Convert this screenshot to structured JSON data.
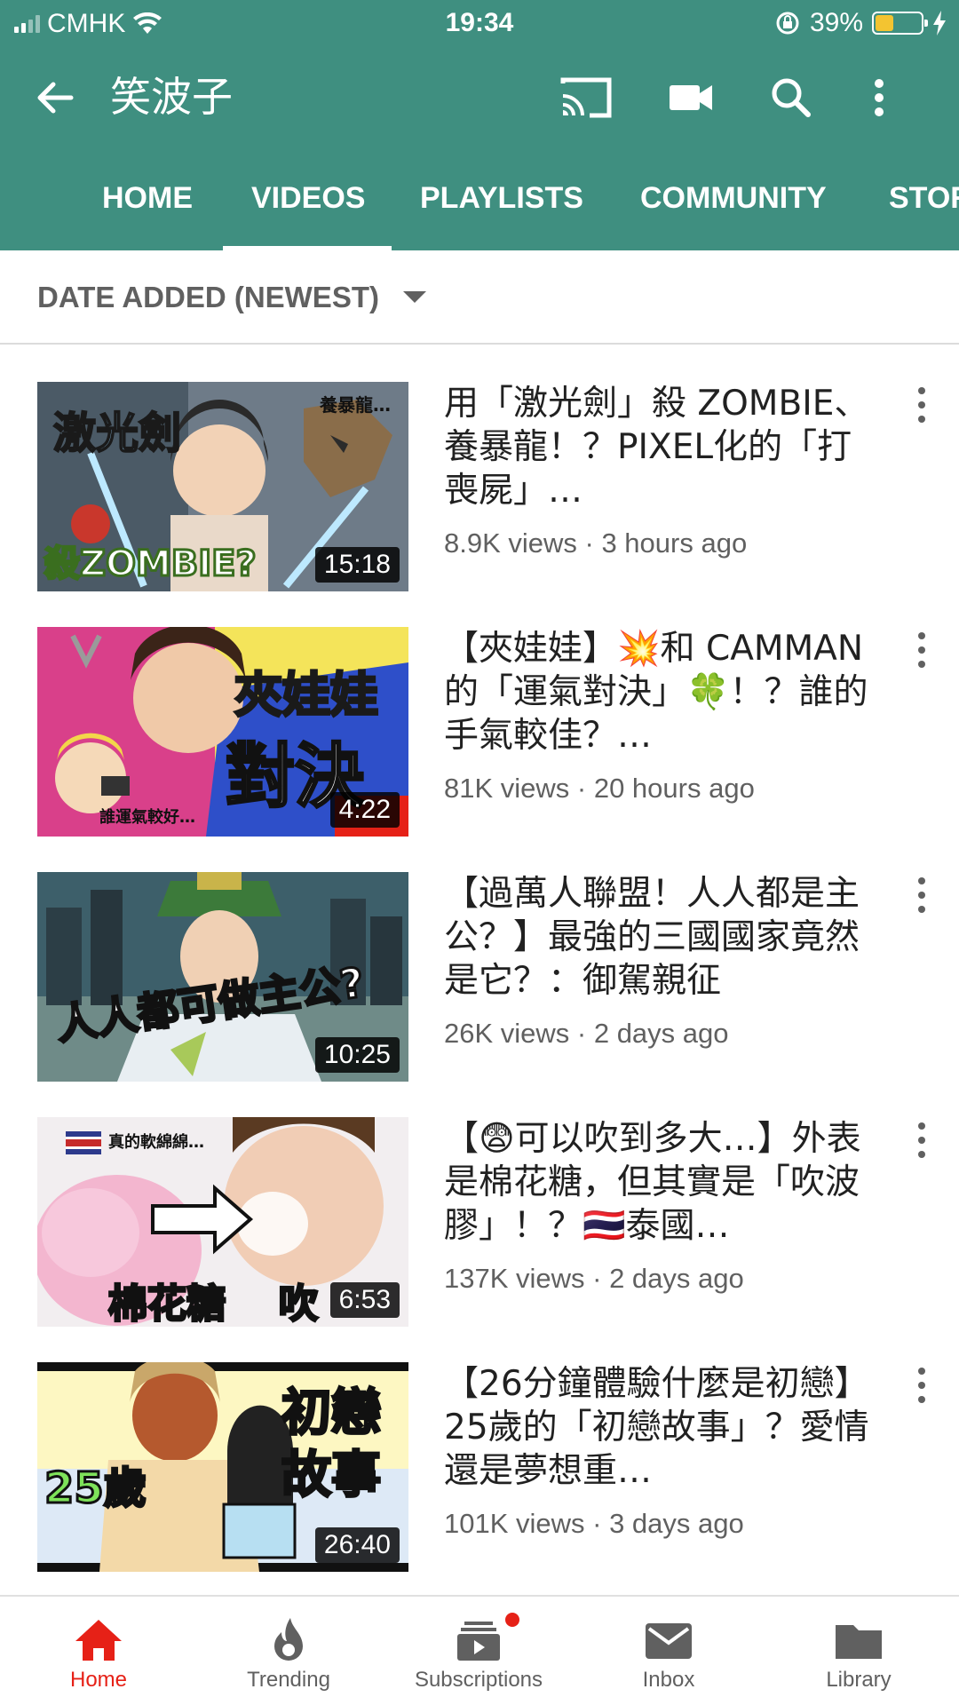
{
  "status_bar": {
    "carrier": "CMHK",
    "time": "19:34",
    "battery_percent": "39%",
    "battery_level": 0.39,
    "battery_color": "#f3c431"
  },
  "header": {
    "background": "#3f8f80",
    "channel_title": "笑波子",
    "icons": [
      "back-arrow-icon",
      "cast-icon",
      "camera-icon",
      "search-icon",
      "more-vert-icon"
    ]
  },
  "tabs": [
    {
      "label": "HOME",
      "active": false
    },
    {
      "label": "VIDEOS",
      "active": true
    },
    {
      "label": "PLAYLISTS",
      "active": false
    },
    {
      "label": "COMMUNITY",
      "active": false
    },
    {
      "label": "STOR",
      "active": false
    }
  ],
  "sort": {
    "label": "DATE ADDED (NEWEST)"
  },
  "videos": [
    {
      "title": "用「激光劍」殺 ZOMBIE、養暴龍！？PIXEL化的「打喪屍」…",
      "meta": "8.9K views · 3 hours ago",
      "duration": "15:18",
      "thumb_text": [
        "激光劍",
        "養暴龍…",
        "殺ZOMBIE?"
      ]
    },
    {
      "title": "【夾娃娃】💥和 CAMMAN的「運氣對決」🍀！？誰的手氣較佳？…",
      "meta": "81K views · 20 hours ago",
      "duration": "4:22",
      "thumb_text": [
        "夾娃娃",
        "對決",
        "誰運氣較好…"
      ]
    },
    {
      "title": "【過萬人聯盟！人人都是主公？】最強的三國國家竟然是它？：御駕親征",
      "meta": "26K views · 2 days ago",
      "duration": "10:25",
      "thumb_text": [
        "人人都可做主公?"
      ]
    },
    {
      "title": "【😨可以吹到多大…】外表是棉花糖，但其實是「吹波膠」！？🇹🇭泰國…",
      "meta": "137K views · 2 days ago",
      "duration": "6:53",
      "thumb_text": [
        "真的軟綿綿…",
        "棉花糖",
        "吹"
      ]
    },
    {
      "title": "【26分鐘體驗什麼是初戀】25歲的「初戀故事」？愛情還是夢想重…",
      "meta": "101K views · 3 days ago",
      "duration": "26:40",
      "thumb_text": [
        "初戀",
        "故事",
        "25歲"
      ]
    }
  ],
  "bottom_nav": [
    {
      "label": "Home",
      "icon": "home-icon",
      "active": true
    },
    {
      "label": "Trending",
      "icon": "trending-flame-icon",
      "active": false
    },
    {
      "label": "Subscriptions",
      "icon": "subscriptions-icon",
      "active": false,
      "badge": true
    },
    {
      "label": "Inbox",
      "icon": "inbox-mail-icon",
      "active": false
    },
    {
      "label": "Library",
      "icon": "library-folder-icon",
      "active": false
    }
  ],
  "colors": {
    "accent_red": "#e62117",
    "header_teal": "#3f8f80",
    "text_primary": "#212121",
    "text_secondary": "#606060"
  }
}
